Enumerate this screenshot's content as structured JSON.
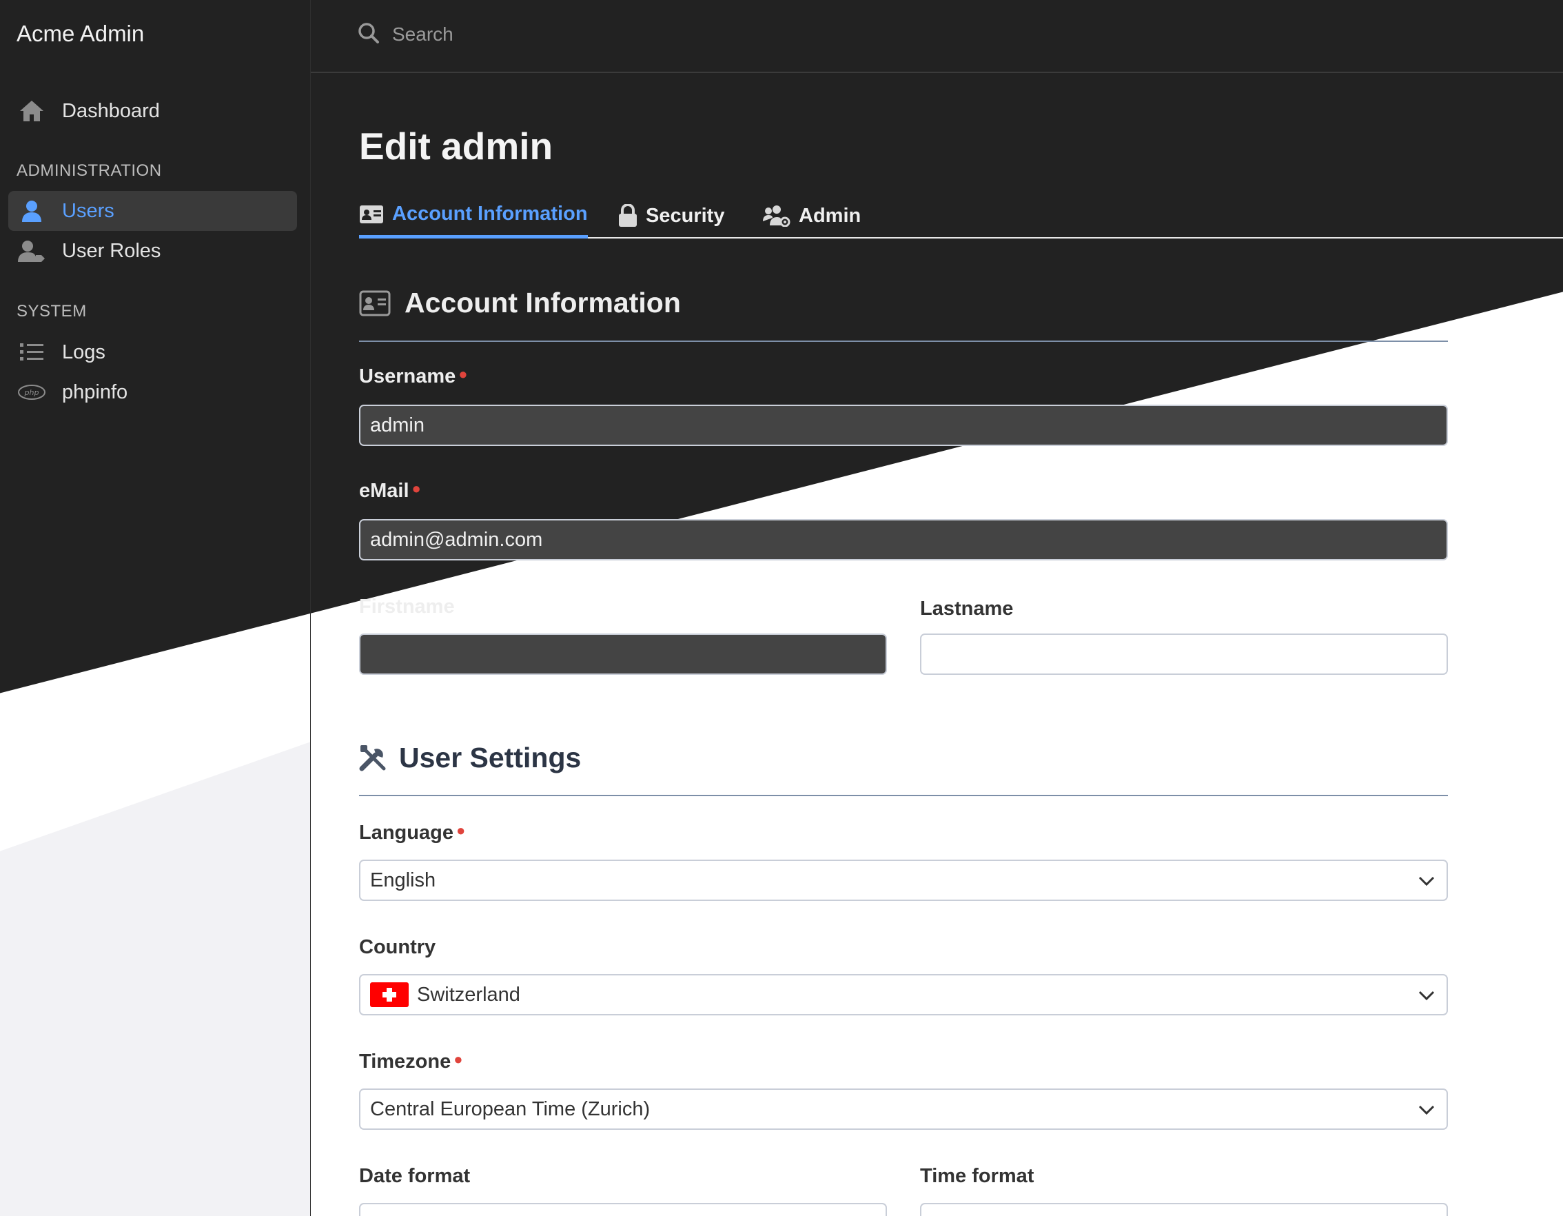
{
  "app": {
    "title": "Acme Admin"
  },
  "search": {
    "placeholder": "Search"
  },
  "sidebar": {
    "items": [
      {
        "label": "Dashboard",
        "icon": "home-icon"
      },
      {
        "label": "Users",
        "icon": "user-icon",
        "active": true
      },
      {
        "label": "User Roles",
        "icon": "user-tag-icon"
      },
      {
        "label": "Logs",
        "icon": "list-icon"
      },
      {
        "label": "phpinfo",
        "icon": "php-icon"
      }
    ],
    "sections": {
      "administration": "ADMINISTRATION",
      "system": "SYSTEM"
    }
  },
  "page": {
    "title": "Edit admin"
  },
  "tabs": [
    {
      "label": "Account Information",
      "icon": "id-card-icon",
      "active": true
    },
    {
      "label": "Security",
      "icon": "lock-icon"
    },
    {
      "label": "Admin",
      "icon": "users-cog-icon"
    }
  ],
  "account": {
    "title": "Account Information",
    "username_label": "Username",
    "username_value": "admin",
    "email_label": "eMail",
    "email_value": "admin@admin.com",
    "firstname_label": "Firstname",
    "firstname_value": "",
    "lastname_label": "Lastname",
    "lastname_value": ""
  },
  "settings": {
    "title": "User Settings",
    "language_label": "Language",
    "language_value": "English",
    "country_label": "Country",
    "country_value": "Switzerland",
    "timezone_label": "Timezone",
    "timezone_value": "Central European Time (Zurich)",
    "dateformat_label": "Date format",
    "timeformat_label": "Time format"
  },
  "colors": {
    "accent": "#5aa0ff",
    "required": "#e0443c",
    "dark_bg": "#222222"
  }
}
